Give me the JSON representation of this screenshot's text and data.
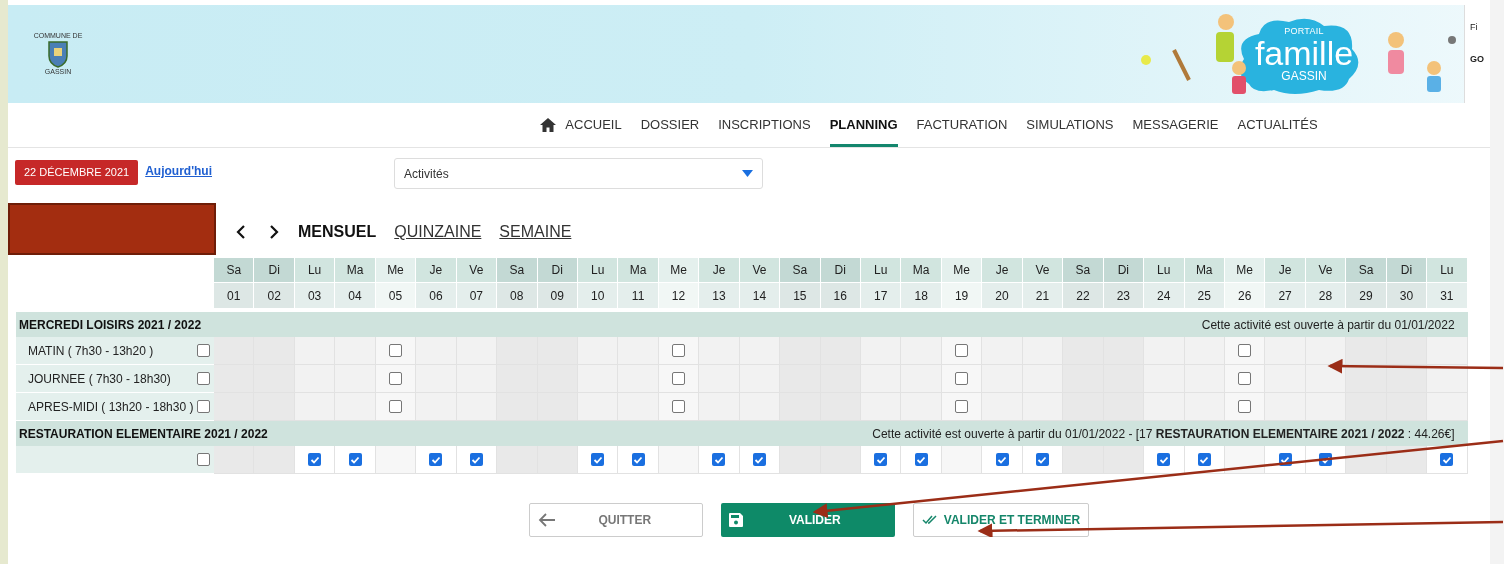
{
  "header": {
    "commune_logo": {
      "top": "COMMUNE DE",
      "bottom": "GASSIN"
    },
    "portal_logo": {
      "line1": "PORTAIL",
      "line2": "famille",
      "line3": "GASSIN"
    },
    "edge_texts": [
      "Fi",
      "GO"
    ]
  },
  "nav": [
    {
      "label": "ACCUEIL",
      "selected": false
    },
    {
      "label": "DOSSIER",
      "selected": false
    },
    {
      "label": "INSCRIPTIONS",
      "selected": false
    },
    {
      "label": "PLANNING",
      "selected": true
    },
    {
      "label": "FACTURATION",
      "selected": false
    },
    {
      "label": "SIMULATIONS",
      "selected": false
    },
    {
      "label": "MESSAGERIE",
      "selected": false
    },
    {
      "label": "ACTUALITÉS",
      "selected": false
    }
  ],
  "date_badge": "22 DÉCEMBRE 2021",
  "today_link": "Aujourd'hui",
  "activity_select": {
    "value": "Activités"
  },
  "views": [
    {
      "label": "MENSUEL",
      "selected": true
    },
    {
      "label": "QUINZAINE",
      "selected": false
    },
    {
      "label": "SEMAINE",
      "selected": false
    }
  ],
  "days": [
    {
      "dow": "Sa",
      "num": "01",
      "kind": "weekend"
    },
    {
      "dow": "Di",
      "num": "02",
      "kind": "weekend"
    },
    {
      "dow": "Lu",
      "num": "03",
      "kind": "weekday"
    },
    {
      "dow": "Ma",
      "num": "04",
      "kind": "weekday"
    },
    {
      "dow": "Me",
      "num": "05",
      "kind": "wednesday"
    },
    {
      "dow": "Je",
      "num": "06",
      "kind": "weekday"
    },
    {
      "dow": "Ve",
      "num": "07",
      "kind": "weekday"
    },
    {
      "dow": "Sa",
      "num": "08",
      "kind": "weekend"
    },
    {
      "dow": "Di",
      "num": "09",
      "kind": "weekend"
    },
    {
      "dow": "Lu",
      "num": "10",
      "kind": "weekday"
    },
    {
      "dow": "Ma",
      "num": "11",
      "kind": "weekday"
    },
    {
      "dow": "Me",
      "num": "12",
      "kind": "wednesday"
    },
    {
      "dow": "Je",
      "num": "13",
      "kind": "weekday"
    },
    {
      "dow": "Ve",
      "num": "14",
      "kind": "weekday"
    },
    {
      "dow": "Sa",
      "num": "15",
      "kind": "weekend"
    },
    {
      "dow": "Di",
      "num": "16",
      "kind": "weekend"
    },
    {
      "dow": "Lu",
      "num": "17",
      "kind": "weekday"
    },
    {
      "dow": "Ma",
      "num": "18",
      "kind": "weekday"
    },
    {
      "dow": "Me",
      "num": "19",
      "kind": "wednesday"
    },
    {
      "dow": "Je",
      "num": "20",
      "kind": "weekday"
    },
    {
      "dow": "Ve",
      "num": "21",
      "kind": "weekday"
    },
    {
      "dow": "Sa",
      "num": "22",
      "kind": "weekend"
    },
    {
      "dow": "Di",
      "num": "23",
      "kind": "weekend"
    },
    {
      "dow": "Lu",
      "num": "24",
      "kind": "weekday"
    },
    {
      "dow": "Ma",
      "num": "25",
      "kind": "weekday"
    },
    {
      "dow": "Me",
      "num": "26",
      "kind": "wednesday"
    },
    {
      "dow": "Je",
      "num": "27",
      "kind": "weekday"
    },
    {
      "dow": "Ve",
      "num": "28",
      "kind": "weekday"
    },
    {
      "dow": "Sa",
      "num": "29",
      "kind": "weekend"
    },
    {
      "dow": "Di",
      "num": "30",
      "kind": "weekend"
    },
    {
      "dow": "Lu",
      "num": "31",
      "kind": "weekday"
    }
  ],
  "groups": [
    {
      "title": "MERCREDI LOISIRS 2021 / 2022",
      "note": "Cette activité est ouverte à partir du 01/01/2022",
      "rows": [
        {
          "label": "MATIN ( 7h30 - 13h20 )",
          "checked": false,
          "cells": [
            null,
            null,
            null,
            null,
            false,
            null,
            null,
            null,
            null,
            null,
            null,
            false,
            null,
            null,
            null,
            null,
            null,
            null,
            false,
            null,
            null,
            null,
            null,
            null,
            null,
            false,
            null,
            null,
            null,
            null,
            null
          ]
        },
        {
          "label": "JOURNEE ( 7h30 - 18h30)",
          "checked": false,
          "cells": [
            null,
            null,
            null,
            null,
            false,
            null,
            null,
            null,
            null,
            null,
            null,
            false,
            null,
            null,
            null,
            null,
            null,
            null,
            false,
            null,
            null,
            null,
            null,
            null,
            null,
            false,
            null,
            null,
            null,
            null,
            null
          ]
        },
        {
          "label": "APRES-MIDI ( 13h20 - 18h30 )",
          "checked": false,
          "cells": [
            null,
            null,
            null,
            null,
            false,
            null,
            null,
            null,
            null,
            null,
            null,
            false,
            null,
            null,
            null,
            null,
            null,
            null,
            false,
            null,
            null,
            null,
            null,
            null,
            null,
            false,
            null,
            null,
            null,
            null,
            null
          ]
        }
      ]
    },
    {
      "title": "RESTAURATION ELEMENTAIRE 2021 / 2022",
      "note": "Cette activité est ouverte à partir du 01/01/2022 - [17 **RESTAURATION ELEMENTAIRE 2021 / 2022** : 44.26€]",
      "rows": [
        {
          "checked": false,
          "cells": [
            null,
            null,
            true,
            true,
            null,
            true,
            true,
            null,
            null,
            true,
            true,
            null,
            true,
            true,
            null,
            null,
            true,
            true,
            null,
            true,
            true,
            null,
            null,
            true,
            true,
            null,
            true,
            true,
            null,
            null,
            true
          ]
        }
      ]
    }
  ],
  "buttons": [
    {
      "label": "QUITTER",
      "kind": "back"
    },
    {
      "label": "VALIDER",
      "kind": "save"
    },
    {
      "label": "VALIDER ET TERMINER",
      "kind": "done"
    }
  ]
}
